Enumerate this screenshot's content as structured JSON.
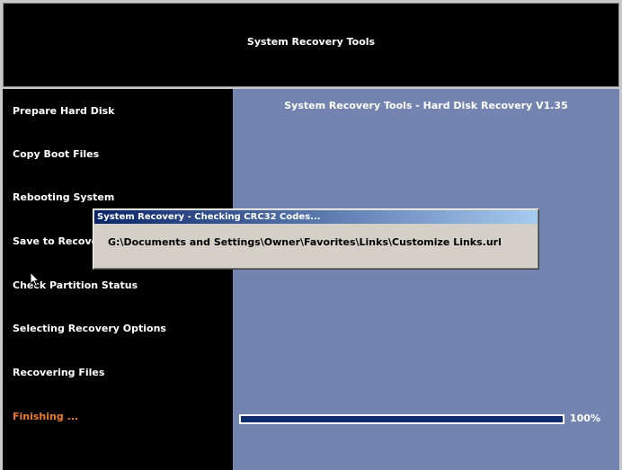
{
  "header": {
    "title": "System Recovery Tools"
  },
  "sidebar": {
    "steps": [
      {
        "label": "Prepare Hard Disk"
      },
      {
        "label": "Copy Boot Files"
      },
      {
        "label": "Rebooting System"
      },
      {
        "label": "Save to Recovery"
      },
      {
        "label": "Check Partition Status"
      },
      {
        "label": "Selecting Recovery Options"
      },
      {
        "label": "Recovering Files"
      },
      {
        "label": "Finishing ..."
      }
    ],
    "active_step": "Finishing ...",
    "active_color": "#ee7a2a"
  },
  "main": {
    "title": "System Recovery Tools - Hard Disk Recovery V1.35",
    "progress": {
      "value": 1.0,
      "label": "100%"
    }
  },
  "dialog": {
    "title": "System Recovery - Checking CRC32 Codes...",
    "message": "G:\\Documents and Settings\\Owner\\Favorites\\Links\\Customize Links.url"
  },
  "colors": {
    "panel_bg": "#7384b1",
    "sidebar_bg": "#000000",
    "progress_fill": "#0f2c6d"
  }
}
